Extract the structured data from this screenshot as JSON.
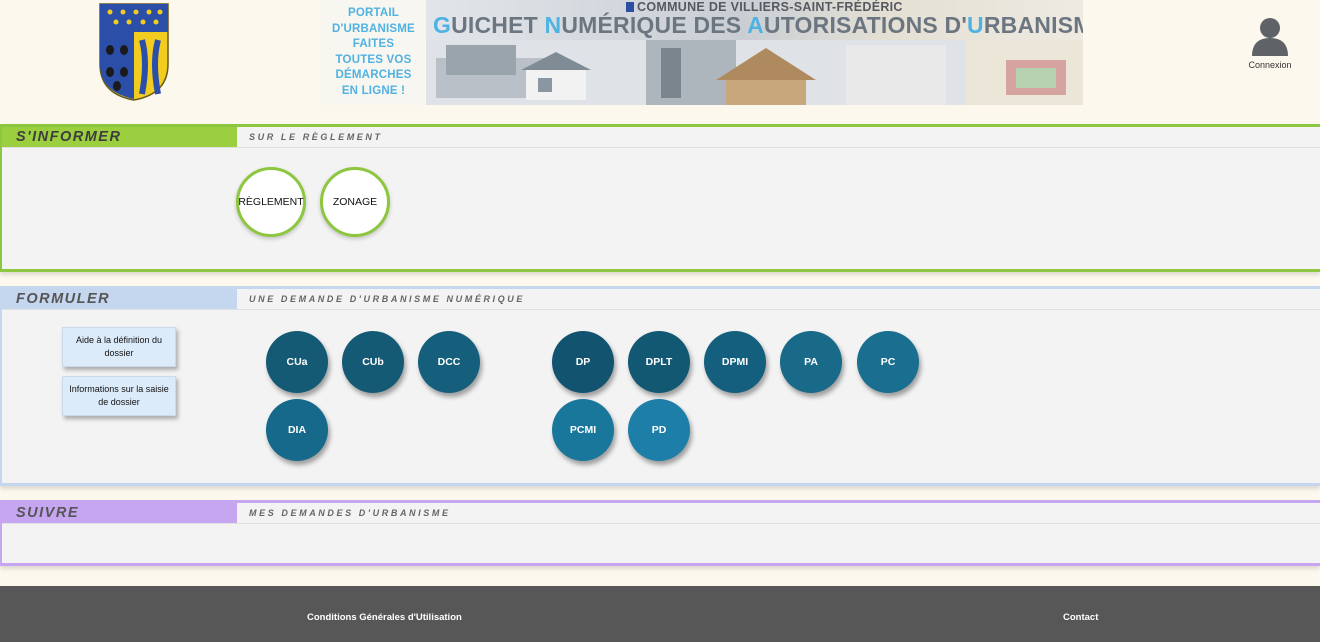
{
  "header": {
    "banner_tagline": "PORTAIL\nD'URBANISME\nFAITES\nTOUTES VOS\nDÉMARCHES\nEN LIGNE !",
    "banner_commune": "COMMUNE DE VILLIERS-SAINT-FRÉDÉRIC",
    "banner_title_parts": [
      "G",
      "UICHET ",
      "N",
      "UMÉRIQUE DES ",
      "A",
      "UTORISATIONS D'",
      "U",
      "RBANISME"
    ],
    "login_label": "Connexion",
    "login_icon": "user-icon"
  },
  "informer": {
    "title": "S'INFORMER",
    "subtitle": "SUR LE RÈGLEMENT",
    "accent": "#8dc63f",
    "buttons": [
      "RÈGLEMENT",
      "ZONAGE"
    ]
  },
  "formuler": {
    "title": "FORMULER",
    "subtitle": "UNE DEMANDE D'URBANISME NUMÉRIQUE",
    "accent": "#c5d7ee",
    "info_buttons": [
      "Aide à la définition du dossier",
      "Informations sur la saisie de dossier"
    ],
    "requests": [
      {
        "label": "CUa",
        "color": "#155a75"
      },
      {
        "label": "CUb",
        "color": "#155a75"
      },
      {
        "label": "DCC",
        "color": "#155f7d"
      },
      {
        "label": "DIA",
        "color": "#16698a"
      },
      {
        "label": "DP",
        "color": "#125470"
      },
      {
        "label": "DPLT",
        "color": "#135873"
      },
      {
        "label": "DPMI",
        "color": "#155f7e"
      },
      {
        "label": "PA",
        "color": "#196989"
      },
      {
        "label": "PC",
        "color": "#1a6e90"
      },
      {
        "label": "PCMI",
        "color": "#1a779c"
      },
      {
        "label": "PD",
        "color": "#1d7fa8"
      }
    ]
  },
  "suivre": {
    "title": "SUIVRE",
    "subtitle": "MES DEMANDES D'URBANISME",
    "accent": "#c6a6f0"
  },
  "footer": {
    "cgu": "Conditions Générales d'Utilisation",
    "contact": "Contact"
  }
}
